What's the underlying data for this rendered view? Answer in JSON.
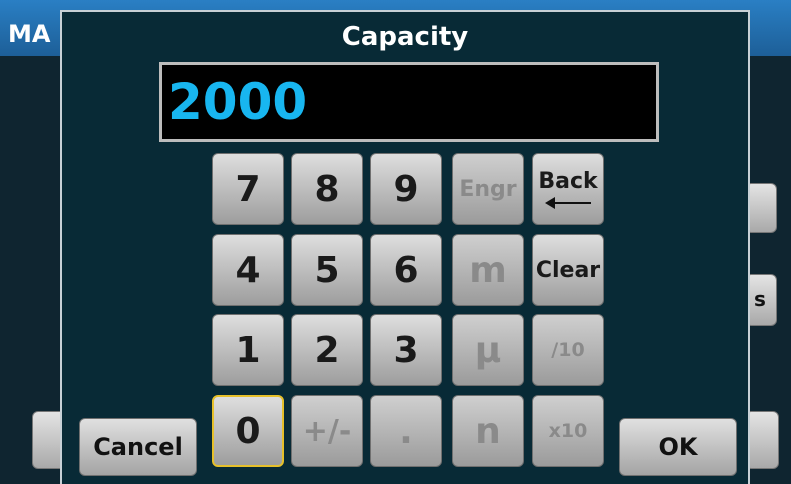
{
  "app": {
    "title_fragment": "MA",
    "partial_button_label": "s"
  },
  "dialog": {
    "title": "Capacity",
    "display_value": "2000",
    "keys": {
      "k7": "7",
      "k8": "8",
      "k9": "9",
      "engr": "Engr",
      "back": "Back",
      "k4": "4",
      "k5": "5",
      "k6": "6",
      "m": "m",
      "clear": "Clear",
      "k1": "1",
      "k2": "2",
      "k3": "3",
      "mu": "μ",
      "div10": "/10",
      "k0": "0",
      "plusminus": "+/-",
      "dot": ".",
      "n": "n",
      "x10": "x10"
    },
    "cancel_label": "Cancel",
    "ok_label": "OK"
  },
  "colors": {
    "display_text": "#18b6f0",
    "dialog_bg": "#082a36",
    "focus_border": "#e6c02a"
  },
  "icons": {
    "back": "left-arrow-icon"
  }
}
